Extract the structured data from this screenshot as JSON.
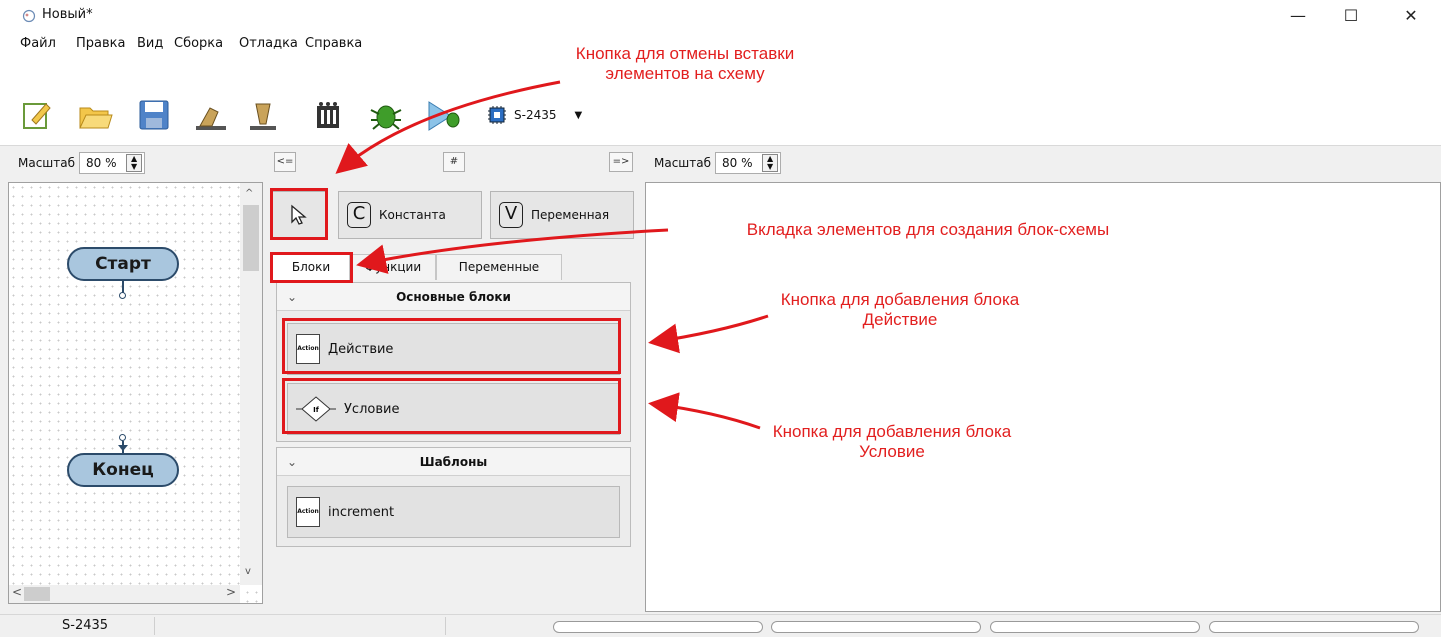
{
  "window": {
    "title": "Новый*",
    "minimize": "—",
    "maximize": "☐",
    "close": "✕"
  },
  "menu": [
    "Файл",
    "Правка",
    "Вид",
    "Сборка",
    "Отладка",
    "Справка"
  ],
  "toolbar": {
    "device_label": "S-2435",
    "device_dropdown": "▼",
    "icons": [
      "new-file-icon",
      "open-folder-icon",
      "save-icon",
      "upload-icon",
      "download-icon",
      "chip-icon",
      "debug-bug-icon",
      "run-debug-icon"
    ]
  },
  "left_pane": {
    "scale_label": "Масштаб",
    "scale_value": "80 %",
    "start_block": "Старт",
    "end_block": "Конец"
  },
  "middle_pane": {
    "nav_back": "<=",
    "nav_center": "#",
    "nav_forward": "=>",
    "constant_letter": "C",
    "constant_label": "Константа",
    "variable_letter": "V",
    "variable_label": "Переменная",
    "tabs": [
      "Блоки",
      "Функции",
      "Переменные"
    ],
    "groups": [
      {
        "title": "Основные блоки",
        "items": [
          "Действие",
          "Условие"
        ]
      },
      {
        "title": "Шаблоны",
        "items": [
          "increment"
        ]
      }
    ],
    "action_icon_text": "Action",
    "if_icon_text": "If"
  },
  "right_pane": {
    "scale_label": "Масштаб",
    "scale_value": "80 %"
  },
  "statusbar": {
    "device": "S-2435"
  },
  "annotations": {
    "cancel_insert": "Кнопка для отмены вставки элементов на схему",
    "elements_tab": "Вкладка элементов для создания блок-схемы",
    "add_action": "Кнопка для добавления блока Действие",
    "add_condition": "Кнопка для добавления блока Условие"
  },
  "colors": {
    "annotation_red": "#e0181c",
    "terminal_fill": "#a9c6de",
    "terminal_stroke": "#2c4b6a"
  }
}
